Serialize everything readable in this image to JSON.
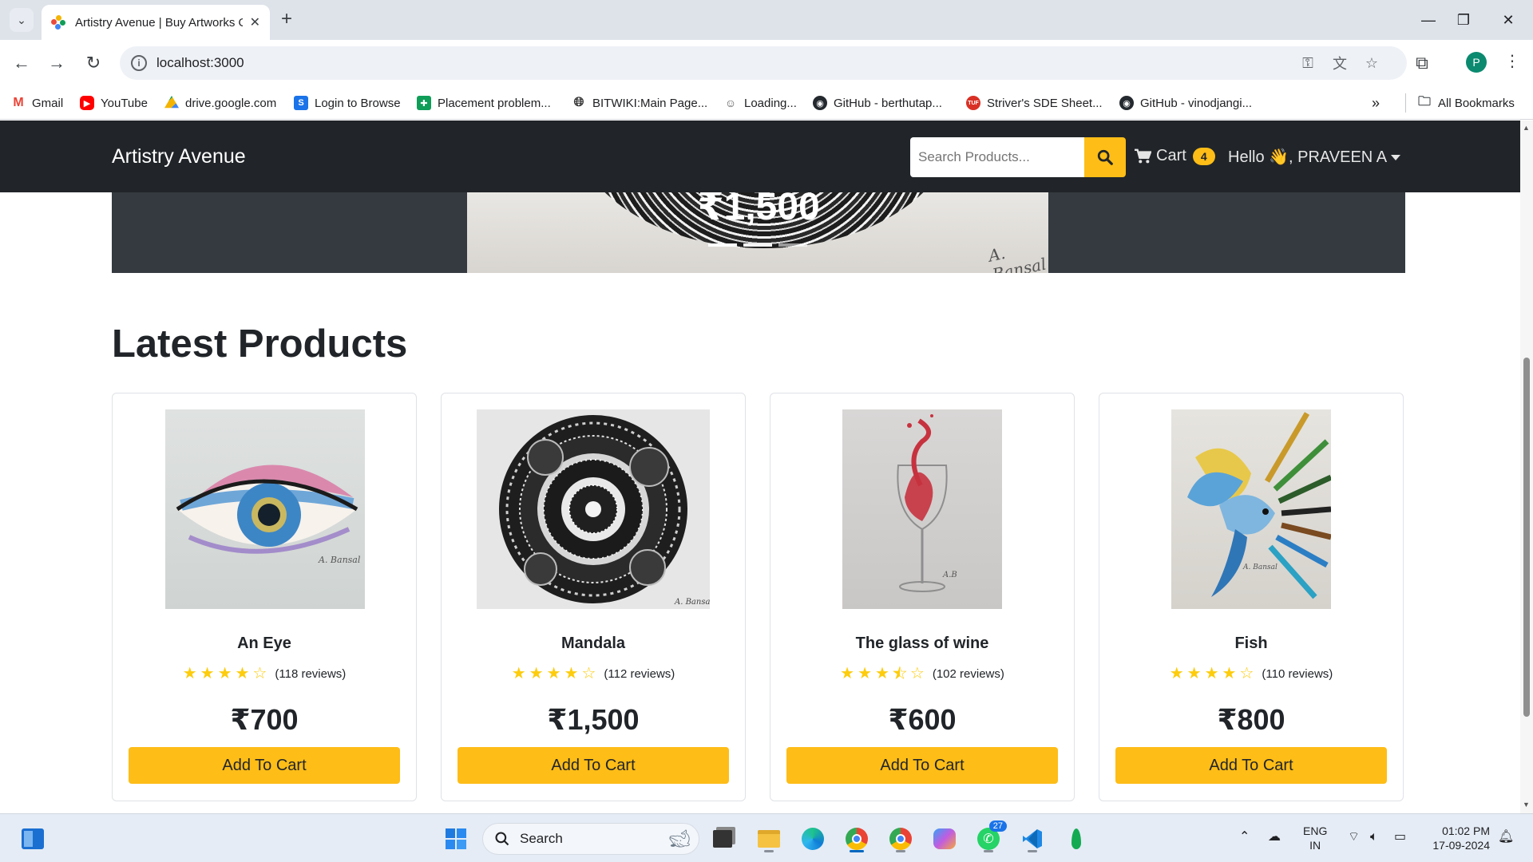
{
  "browser": {
    "tab_title": "Artistry Avenue | Buy Artworks O",
    "url": "localhost:3000",
    "profile_initial": "P",
    "bookmarks": [
      {
        "label": "Gmail",
        "icon": "gmail-icon"
      },
      {
        "label": "YouTube",
        "icon": "youtube-icon"
      },
      {
        "label": "drive.google.com",
        "icon": "drive-icon"
      },
      {
        "label": "Login to Browse",
        "icon": "s-icon"
      },
      {
        "label": "Placement problem...",
        "icon": "sheets-icon"
      },
      {
        "label": "BITWIKI:Main Page...",
        "icon": "globe-icon"
      },
      {
        "label": "Loading...",
        "icon": "avatar-icon"
      },
      {
        "label": "GitHub - berthutap...",
        "icon": "github-icon"
      },
      {
        "label": "Striver's SDE Sheet...",
        "icon": "tuf-icon"
      },
      {
        "label": "GitHub - vinodjangi...",
        "icon": "github-icon"
      }
    ],
    "all_bookmarks": "All Bookmarks"
  },
  "navbar": {
    "brand": "Artistry Avenue",
    "search_placeholder": "Search Products...",
    "cart_label": "Cart",
    "cart_count": "4",
    "user_greeting": "Hello 👋, PRAVEEN A"
  },
  "carousel": {
    "price": "₹1,500",
    "slides": 3,
    "active_slide": 2
  },
  "section_title": "Latest Products",
  "products": [
    {
      "name": "An Eye",
      "rating": 4,
      "reviews": "(118 reviews)",
      "price": "₹700",
      "button": "Add To Cart"
    },
    {
      "name": "Mandala",
      "rating": 4,
      "reviews": "(112 reviews)",
      "price": "₹1,500",
      "button": "Add To Cart"
    },
    {
      "name": "The glass of wine",
      "rating": 3.5,
      "reviews": "(102 reviews)",
      "price": "₹600",
      "button": "Add To Cart"
    },
    {
      "name": "Fish",
      "rating": 4,
      "reviews": "(110 reviews)",
      "price": "₹800",
      "button": "Add To Cart"
    }
  ],
  "taskbar": {
    "search_label": "Search",
    "language": "ENG",
    "region": "IN",
    "time": "01:02 PM",
    "date": "17-09-2024",
    "whatsapp_badge": "27"
  },
  "colors": {
    "navbar_bg": "#212529",
    "accent_yellow": "#febd17",
    "star": "#fdcc0d"
  }
}
